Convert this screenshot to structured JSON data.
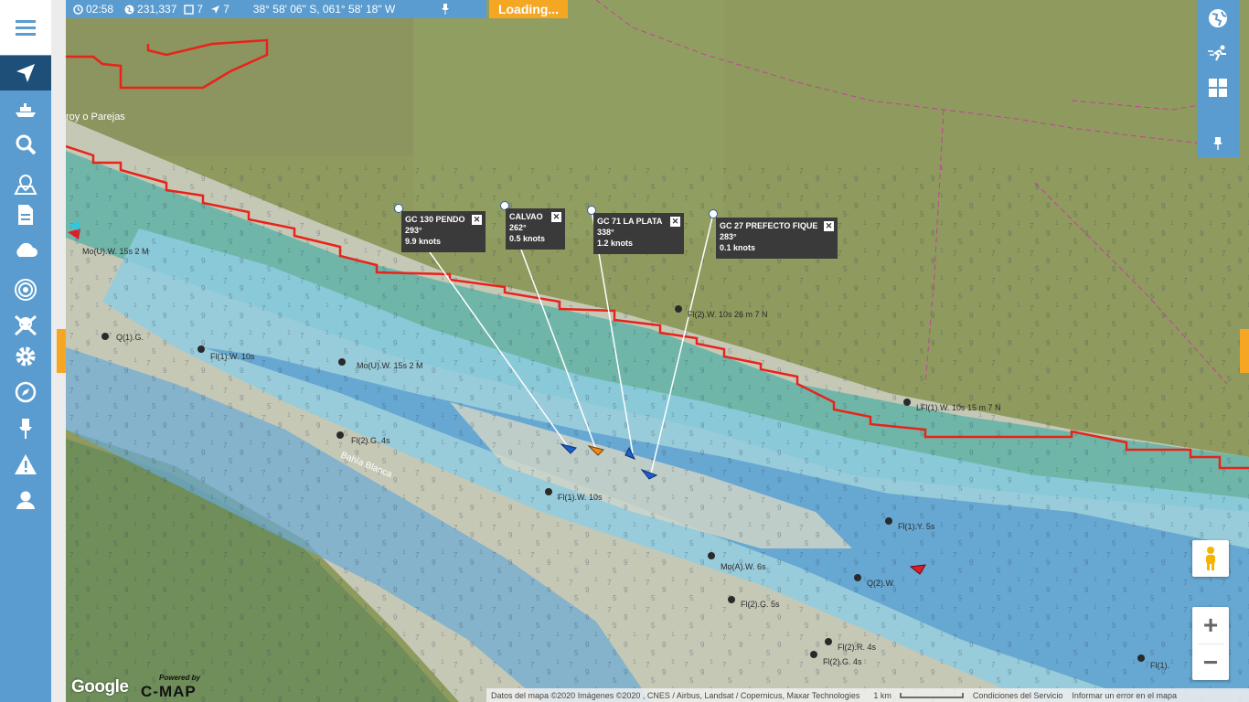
{
  "topbar": {
    "time": "02:58",
    "count": "231,337",
    "stat_a": "7",
    "stat_b": "7",
    "coords": "38° 58' 06\" S, 061° 58' 18\" W",
    "loading": "Loading..."
  },
  "sidebar": {
    "items": [
      {
        "icon": "hamburger-menu-icon"
      },
      {
        "icon": "navigation-arrow-icon",
        "active": true
      },
      {
        "icon": "ship-icon"
      },
      {
        "icon": "search-icon"
      },
      {
        "icon": "map-pin-icon"
      },
      {
        "icon": "document-icon"
      },
      {
        "icon": "cloud-icon"
      },
      {
        "icon": "radar-icon"
      },
      {
        "icon": "skull-icon"
      },
      {
        "icon": "gear-icon"
      },
      {
        "icon": "compass-icon"
      },
      {
        "icon": "pushpin-icon"
      },
      {
        "icon": "warning-icon"
      },
      {
        "icon": "user-icon"
      }
    ]
  },
  "right_panel": {
    "items": [
      {
        "icon": "globe-icon"
      },
      {
        "icon": "runner-icon"
      },
      {
        "icon": "grid-icon"
      },
      {
        "icon": "pushpin-icon"
      }
    ]
  },
  "vessels": [
    {
      "name": "GC 130 PENDO",
      "heading": "293°",
      "speed": "9.9 knots",
      "color": "#1e5fd0"
    },
    {
      "name": "CALVAO",
      "heading": "262°",
      "speed": "0.5 knots",
      "color": "#f08a1c"
    },
    {
      "name": "GC 71 LA PLATA",
      "heading": "338°",
      "speed": "1.2 knots",
      "color": "#1e5fd0"
    },
    {
      "name": "GC 27 PREFECTO FIQUE",
      "heading": "283°",
      "speed": "0.1 knots",
      "color": "#1e5fd0"
    }
  ],
  "map_labels": {
    "place": "roy o Parejas",
    "bay": "Bahía Blanca",
    "lights": [
      "Mo(U).W. 15s 2 M",
      "Q(1).G.",
      "Fl(1).W. 10s",
      "Mo(U).W. 15s 2 M",
      "Fl(2).G. 4s",
      "Fl(1).W. 10s",
      "Fl(2).W. 10s 26 m 7 N",
      "LFl(1).W. 10s 15 m 7 N",
      "Fl(1).Y. 5s",
      "Mo(A).W. 6s",
      "Q(2).W.",
      "Fl(2).G. 5s",
      "Fl(2).R. 4s",
      "Fl(2).G. 4s",
      "Fl(1)."
    ]
  },
  "zoom": {
    "in": "+",
    "out": "−"
  },
  "attribution": {
    "data": "Datos del mapa ©2020 Imágenes ©2020 , CNES / Airbus, Landsat / Copernicus, Maxar Technologies",
    "scale": "1 km",
    "terms": "Condiciones del Servicio",
    "report": "Informar un error en el mapa"
  },
  "logos": {
    "google": "Google",
    "powered": "Powered by",
    "cmap": "C-MAP"
  },
  "colors": {
    "sidebar": "#5a9ccf",
    "sidebar_active": "#1e4f78",
    "accent": "#f5a623",
    "boundary": "#e8231a",
    "water_deep": "#5b9fd0",
    "land": "#8f9a5c"
  }
}
